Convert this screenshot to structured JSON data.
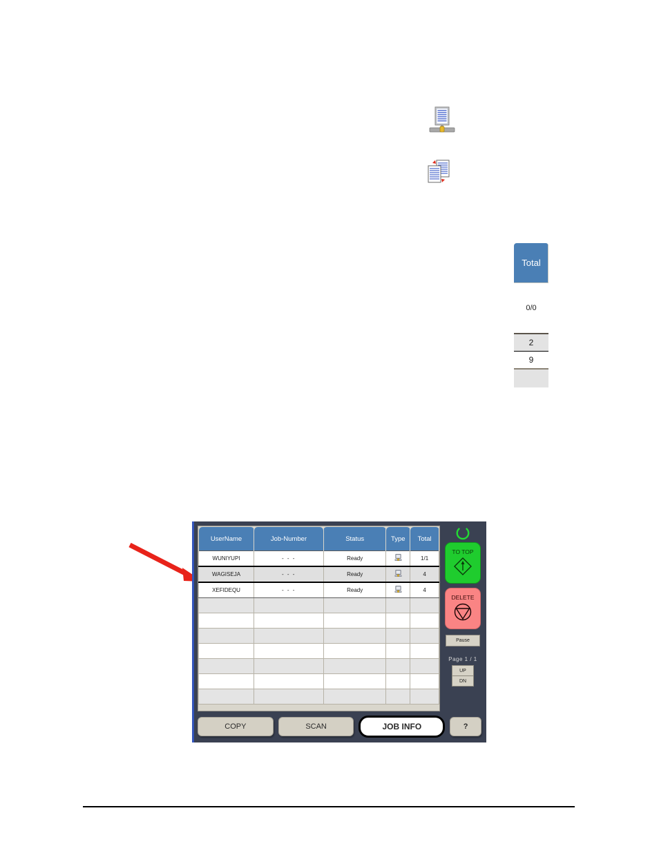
{
  "icons": {
    "network_document": "network-document-icon",
    "copy_documents": "copy-documents-icon",
    "type_column": "computer-pc-icon",
    "status_ring": "ready-ring-icon",
    "to_top_glyph": "diamond-arrow-up-icon",
    "delete_glyph": "circle-triangle-stop-icon"
  },
  "total_widget": {
    "header": "Total",
    "main_value": "0/0",
    "cells": [
      "2",
      "9",
      ""
    ]
  },
  "lcd": {
    "table": {
      "headers": [
        "UserName",
        "Job-Number",
        "Status",
        "Type",
        "Total"
      ],
      "rows": [
        {
          "user": "WUNIYUPI",
          "job": "- - -",
          "status": "Ready",
          "type": "computer-pc-icon",
          "total": "1/1",
          "state": "normal"
        },
        {
          "user": "WAGISEJA",
          "job": "- - -",
          "status": "Ready",
          "type": "computer-pc-icon",
          "total": "4",
          "state": "selected"
        },
        {
          "user": "XEFIDEQU",
          "job": "- - -",
          "status": "Ready",
          "type": "computer-pc-icon",
          "total": "4",
          "state": "normal"
        }
      ],
      "empty_row_count": 7
    },
    "controls": {
      "to_top_label": "TO TOP",
      "delete_label": "DELETE",
      "pause_label": "Pause",
      "page_label": "Page  1 / 1",
      "up_label": "UP",
      "down_label": "DN"
    },
    "tabs": {
      "copy": "COPY",
      "scan": "SCAN",
      "job_info": "JOB INFO",
      "help": "?"
    }
  },
  "colors": {
    "header_blue": "#4a7fb5",
    "panel_dark": "#3a4152",
    "to_top_green": "#1fcc2e",
    "delete_red": "#fa8484",
    "tab_beige": "#d4d0c4",
    "annotation_red": "#e8231a"
  }
}
